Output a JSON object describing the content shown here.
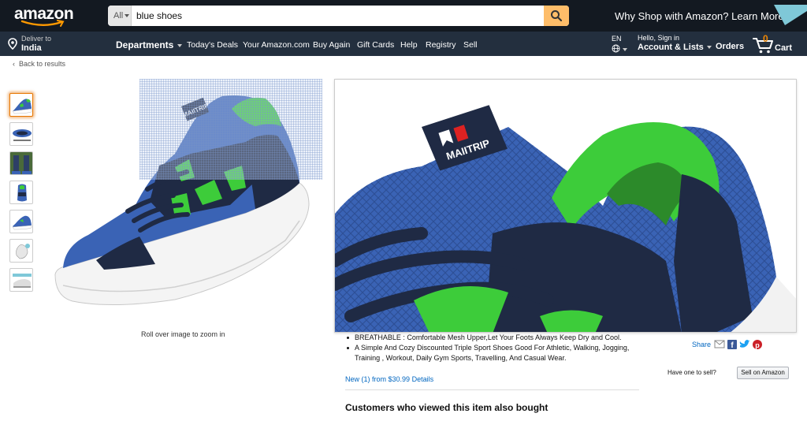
{
  "header": {
    "logo_text": "amazon",
    "search": {
      "category": "All",
      "query": "blue shoes"
    },
    "promo": "Why Shop with Amazon? Learn More",
    "deliver": {
      "line1": "Deliver to",
      "line2": "India"
    },
    "departments": "Departments",
    "nav_links": [
      "Today's Deals",
      "Your Amazon.com",
      "Buy Again",
      "Gift Cards",
      "Help",
      "Registry",
      "Sell"
    ],
    "language": "EN",
    "account": {
      "line1": "Hello, Sign in",
      "line2": "Account & Lists"
    },
    "orders": "Orders",
    "cart": {
      "count": "0",
      "label": "Cart"
    }
  },
  "breadcrumb": {
    "back": "Back to results"
  },
  "gallery": {
    "thumbnail_count": 7,
    "selected_index": 0,
    "rollover_hint": "Roll over image to zoom in",
    "brand_text": "MAIITRIP"
  },
  "product": {
    "bullets": [
      "BREATHABLE : Comfortable Mesh Upper,Let Your Foots Always Keep Dry and Cool.",
      "A Simple And Cozy Discounted Triple Sport Shoes Good For Athletic, Walking, Jogging, Training , Workout, Daily Gym Sports, Travelling, And Casual Wear."
    ],
    "new_offers": {
      "label": "New (1) from",
      "price": "$30.99",
      "details": "Details"
    },
    "also_bought_heading": "Customers who viewed this item also bought"
  },
  "side": {
    "share_label": "Share",
    "sell_question": "Have one to sell?",
    "sell_button": "Sell on Amazon"
  },
  "colors": {
    "nav_dark": "#131921",
    "nav_secondary": "#232f3e",
    "search_button": "#febd69",
    "cart_count": "#f08804",
    "link": "#0066c0",
    "shoe_blue": "#3a63b5",
    "shoe_navy": "#1f2a44",
    "shoe_green": "#3dcc3a"
  },
  "icons": [
    "location-pin-icon",
    "search-icon",
    "globe-icon",
    "cart-icon",
    "mail-icon",
    "facebook-icon",
    "twitter-icon",
    "pinterest-icon"
  ]
}
